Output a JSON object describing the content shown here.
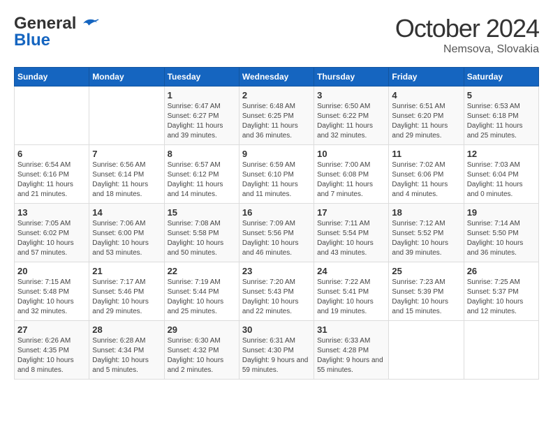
{
  "header": {
    "logo_line1": "General",
    "logo_line2": "Blue",
    "month": "October 2024",
    "location": "Nemsova, Slovakia"
  },
  "days_of_week": [
    "Sunday",
    "Monday",
    "Tuesday",
    "Wednesday",
    "Thursday",
    "Friday",
    "Saturday"
  ],
  "weeks": [
    [
      {
        "day": "",
        "sunrise": "",
        "sunset": "",
        "daylight": ""
      },
      {
        "day": "",
        "sunrise": "",
        "sunset": "",
        "daylight": ""
      },
      {
        "day": "1",
        "sunrise": "Sunrise: 6:47 AM",
        "sunset": "Sunset: 6:27 PM",
        "daylight": "Daylight: 11 hours and 39 minutes."
      },
      {
        "day": "2",
        "sunrise": "Sunrise: 6:48 AM",
        "sunset": "Sunset: 6:25 PM",
        "daylight": "Daylight: 11 hours and 36 minutes."
      },
      {
        "day": "3",
        "sunrise": "Sunrise: 6:50 AM",
        "sunset": "Sunset: 6:22 PM",
        "daylight": "Daylight: 11 hours and 32 minutes."
      },
      {
        "day": "4",
        "sunrise": "Sunrise: 6:51 AM",
        "sunset": "Sunset: 6:20 PM",
        "daylight": "Daylight: 11 hours and 29 minutes."
      },
      {
        "day": "5",
        "sunrise": "Sunrise: 6:53 AM",
        "sunset": "Sunset: 6:18 PM",
        "daylight": "Daylight: 11 hours and 25 minutes."
      }
    ],
    [
      {
        "day": "6",
        "sunrise": "Sunrise: 6:54 AM",
        "sunset": "Sunset: 6:16 PM",
        "daylight": "Daylight: 11 hours and 21 minutes."
      },
      {
        "day": "7",
        "sunrise": "Sunrise: 6:56 AM",
        "sunset": "Sunset: 6:14 PM",
        "daylight": "Daylight: 11 hours and 18 minutes."
      },
      {
        "day": "8",
        "sunrise": "Sunrise: 6:57 AM",
        "sunset": "Sunset: 6:12 PM",
        "daylight": "Daylight: 11 hours and 14 minutes."
      },
      {
        "day": "9",
        "sunrise": "Sunrise: 6:59 AM",
        "sunset": "Sunset: 6:10 PM",
        "daylight": "Daylight: 11 hours and 11 minutes."
      },
      {
        "day": "10",
        "sunrise": "Sunrise: 7:00 AM",
        "sunset": "Sunset: 6:08 PM",
        "daylight": "Daylight: 11 hours and 7 minutes."
      },
      {
        "day": "11",
        "sunrise": "Sunrise: 7:02 AM",
        "sunset": "Sunset: 6:06 PM",
        "daylight": "Daylight: 11 hours and 4 minutes."
      },
      {
        "day": "12",
        "sunrise": "Sunrise: 7:03 AM",
        "sunset": "Sunset: 6:04 PM",
        "daylight": "Daylight: 11 hours and 0 minutes."
      }
    ],
    [
      {
        "day": "13",
        "sunrise": "Sunrise: 7:05 AM",
        "sunset": "Sunset: 6:02 PM",
        "daylight": "Daylight: 10 hours and 57 minutes."
      },
      {
        "day": "14",
        "sunrise": "Sunrise: 7:06 AM",
        "sunset": "Sunset: 6:00 PM",
        "daylight": "Daylight: 10 hours and 53 minutes."
      },
      {
        "day": "15",
        "sunrise": "Sunrise: 7:08 AM",
        "sunset": "Sunset: 5:58 PM",
        "daylight": "Daylight: 10 hours and 50 minutes."
      },
      {
        "day": "16",
        "sunrise": "Sunrise: 7:09 AM",
        "sunset": "Sunset: 5:56 PM",
        "daylight": "Daylight: 10 hours and 46 minutes."
      },
      {
        "day": "17",
        "sunrise": "Sunrise: 7:11 AM",
        "sunset": "Sunset: 5:54 PM",
        "daylight": "Daylight: 10 hours and 43 minutes."
      },
      {
        "day": "18",
        "sunrise": "Sunrise: 7:12 AM",
        "sunset": "Sunset: 5:52 PM",
        "daylight": "Daylight: 10 hours and 39 minutes."
      },
      {
        "day": "19",
        "sunrise": "Sunrise: 7:14 AM",
        "sunset": "Sunset: 5:50 PM",
        "daylight": "Daylight: 10 hours and 36 minutes."
      }
    ],
    [
      {
        "day": "20",
        "sunrise": "Sunrise: 7:15 AM",
        "sunset": "Sunset: 5:48 PM",
        "daylight": "Daylight: 10 hours and 32 minutes."
      },
      {
        "day": "21",
        "sunrise": "Sunrise: 7:17 AM",
        "sunset": "Sunset: 5:46 PM",
        "daylight": "Daylight: 10 hours and 29 minutes."
      },
      {
        "day": "22",
        "sunrise": "Sunrise: 7:19 AM",
        "sunset": "Sunset: 5:44 PM",
        "daylight": "Daylight: 10 hours and 25 minutes."
      },
      {
        "day": "23",
        "sunrise": "Sunrise: 7:20 AM",
        "sunset": "Sunset: 5:43 PM",
        "daylight": "Daylight: 10 hours and 22 minutes."
      },
      {
        "day": "24",
        "sunrise": "Sunrise: 7:22 AM",
        "sunset": "Sunset: 5:41 PM",
        "daylight": "Daylight: 10 hours and 19 minutes."
      },
      {
        "day": "25",
        "sunrise": "Sunrise: 7:23 AM",
        "sunset": "Sunset: 5:39 PM",
        "daylight": "Daylight: 10 hours and 15 minutes."
      },
      {
        "day": "26",
        "sunrise": "Sunrise: 7:25 AM",
        "sunset": "Sunset: 5:37 PM",
        "daylight": "Daylight: 10 hours and 12 minutes."
      }
    ],
    [
      {
        "day": "27",
        "sunrise": "Sunrise: 6:26 AM",
        "sunset": "Sunset: 4:35 PM",
        "daylight": "Daylight: 10 hours and 8 minutes."
      },
      {
        "day": "28",
        "sunrise": "Sunrise: 6:28 AM",
        "sunset": "Sunset: 4:34 PM",
        "daylight": "Daylight: 10 hours and 5 minutes."
      },
      {
        "day": "29",
        "sunrise": "Sunrise: 6:30 AM",
        "sunset": "Sunset: 4:32 PM",
        "daylight": "Daylight: 10 hours and 2 minutes."
      },
      {
        "day": "30",
        "sunrise": "Sunrise: 6:31 AM",
        "sunset": "Sunset: 4:30 PM",
        "daylight": "Daylight: 9 hours and 59 minutes."
      },
      {
        "day": "31",
        "sunrise": "Sunrise: 6:33 AM",
        "sunset": "Sunset: 4:28 PM",
        "daylight": "Daylight: 9 hours and 55 minutes."
      },
      {
        "day": "",
        "sunrise": "",
        "sunset": "",
        "daylight": ""
      },
      {
        "day": "",
        "sunrise": "",
        "sunset": "",
        "daylight": ""
      }
    ]
  ]
}
